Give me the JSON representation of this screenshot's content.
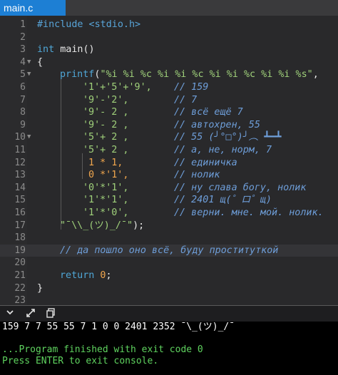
{
  "tab": {
    "title": "main.c"
  },
  "editor": {
    "line_numbers": [
      "1",
      "2",
      "3",
      "4",
      "5",
      "6",
      "7",
      "8",
      "9",
      "10",
      "11",
      "12",
      "13",
      "14",
      "15",
      "16",
      "17",
      "18",
      "19",
      "20",
      "21",
      "22",
      "23"
    ],
    "fold_markers": {
      "line4": "▼",
      "line5": "▼",
      "line10": "▼"
    },
    "code": {
      "l1_include": "#include <stdio.h>",
      "l3_int": "int",
      "l3_main": " main()",
      "l4": "{",
      "l5_printf": "printf",
      "l5_open": "(",
      "l5_fmt": "\"%i %i %c %i %i %c %i %i %c %i %i %s\"",
      "l5_comma": ",",
      "l6_expr": "'1'+'5'+'9',",
      "l6_cm": "// 159",
      "l7_expr": "'9'-'2',",
      "l7_cm": "// 7",
      "l8_expr": "'9'- 2 ,",
      "l8_cm": "// всё ещё 7",
      "l9_expr": "'9'- 2 ,",
      "l9_cm": "// автохрен, 55",
      "l10_expr": "'5'+ 2 ,",
      "l10_cm": "// 55 (╯°□°)╯︵ ┻━┻",
      "l11_expr": "'5'+ 2 ,",
      "l11_cm": "// а, не, норм, 7",
      "l12_expr": "1 * 1,",
      "l12_cm": "// единичка",
      "l13_expr": "0 *'1',",
      "l13_cm": "// нолик",
      "l14_expr": "'0'*'1',",
      "l14_cm": "// ну слава богу, нолик",
      "l15_expr": "'1'*'1',",
      "l15_cm": "// 2401 щ(゜ロ゜щ)",
      "l16_expr": "'1'*'0',",
      "l16_cm": "// верни. мне. мой. нолик.",
      "l17_str": "\"¯\\\\_(ツ)_/¯\"",
      "l17_end": ");",
      "l19_cm": "// да пошло оно всё, буду проституткой",
      "l21_return": "return",
      "l21_val": " 0",
      "l21_semi": ";",
      "l22": "}"
    }
  },
  "toolbar": {
    "expand_icon": "chevron-down-icon",
    "fullscreen_icon": "expand-arrows-icon",
    "copy_icon": "copy-icon"
  },
  "console": {
    "output": "159 7 7 55 55 7 1 0 0 2401 2352 ¯\\_(ツ)_/¯",
    "finished": "...Program finished with exit code 0",
    "prompt": "Press ENTER to exit console."
  },
  "colors": {
    "tab_active": "#1d7fd4",
    "keyword": "#4fa6d6",
    "string": "#9fd07a",
    "number": "#f0a64d",
    "comment": "#6e9ed9",
    "console_green": "#5fd35f"
  }
}
